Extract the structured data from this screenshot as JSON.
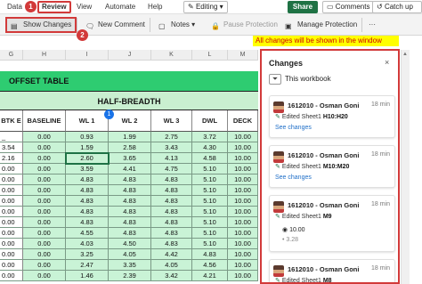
{
  "ribbon_tabs": [
    "Data",
    "Review",
    "View",
    "Automate",
    "Help"
  ],
  "badge_1": "1",
  "badge_2": "2",
  "editing_label": "Editing",
  "share_label": "Share",
  "comments_label": "Comments",
  "catchup_label": "Catch up",
  "commands": {
    "show_changes": "Show Changes",
    "new_comment": "New Comment",
    "notes": "Notes",
    "pause_protection": "Pause Protection",
    "manage_protection": "Manage Protection",
    "more": "···"
  },
  "note_text": "All changes will be shown in the window",
  "grid": {
    "col_letters": [
      "G",
      "H",
      "I",
      "J",
      "K",
      "L",
      "M"
    ],
    "table_title": "OFFSET TABLE",
    "half_breadth": "HALF-BREADTH",
    "headers": [
      "BTK E",
      "BASELINE",
      "WL 1",
      "WL 2",
      "WL 3",
      "DWL",
      "DECK"
    ],
    "rows": [
      [
        "_",
        "0.00",
        "0.93",
        "1.99",
        "2.75",
        "3.72",
        "10.00"
      ],
      [
        "3.54",
        "0.00",
        "1.59",
        "2.58",
        "3.43",
        "4.30",
        "10.00"
      ],
      [
        "2.16",
        "0.00",
        "2.60",
        "3.65",
        "4.13",
        "4.58",
        "10.00"
      ],
      [
        "0.00",
        "0.00",
        "3.59",
        "4.41",
        "4.75",
        "5.10",
        "10.00"
      ],
      [
        "0.00",
        "0.00",
        "4.83",
        "4.83",
        "4.83",
        "5.10",
        "10.00"
      ],
      [
        "0.00",
        "0.00",
        "4.83",
        "4.83",
        "4.83",
        "5.10",
        "10.00"
      ],
      [
        "0.00",
        "0.00",
        "4.83",
        "4.83",
        "4.83",
        "5.10",
        "10.00"
      ],
      [
        "0.00",
        "0.00",
        "4.83",
        "4.83",
        "4.83",
        "5.10",
        "10.00"
      ],
      [
        "0.00",
        "0.00",
        "4.83",
        "4.83",
        "4.83",
        "5.10",
        "10.00"
      ],
      [
        "0.00",
        "0.00",
        "4.55",
        "4.83",
        "4.83",
        "5.10",
        "10.00"
      ],
      [
        "0.00",
        "0.00",
        "4.03",
        "4.50",
        "4.83",
        "5.10",
        "10.00"
      ],
      [
        "0.00",
        "0.00",
        "3.25",
        "4.05",
        "4.42",
        "4.83",
        "10.00"
      ],
      [
        "0.00",
        "0.00",
        "2.47",
        "3.35",
        "4.05",
        "4.56",
        "10.00"
      ],
      [
        "0.00",
        "0.00",
        "1.46",
        "2.39",
        "3.42",
        "4.21",
        "10.00"
      ]
    ],
    "cell_marker": "1"
  },
  "pane": {
    "title": "Changes",
    "close": "×",
    "filter_label": "This workbook",
    "cards": [
      {
        "who": "1612010 - Osman Goni",
        "when": "18 min",
        "edit_prefix": "Edited Sheet1",
        "range": "H10:H20",
        "see": "See changes"
      },
      {
        "who": "1612010 - Osman Goni",
        "when": "18 min",
        "edit_prefix": "Edited Sheet1",
        "range": "M10:M20",
        "see": "See changes"
      },
      {
        "who": "1612010 - Osman Goni",
        "when": "18 min",
        "edit_prefix": "Edited Sheet1",
        "range": "M9",
        "new_value": "10.00",
        "old_value": "3.28"
      },
      {
        "who": "1612010 - Osman Goni",
        "when": "18 min",
        "edit_prefix": "Edited Sheet1",
        "range": "M8"
      }
    ]
  }
}
